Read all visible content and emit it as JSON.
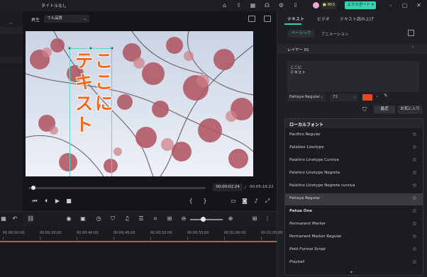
{
  "window": {
    "title": "タイトルなし",
    "credits": "863",
    "export_label": "エクスポート",
    "export_chevron": "▾"
  },
  "player": {
    "quality_label": "再生",
    "quality_value": "フル品質",
    "overlay_text_col1": "テキスト",
    "overlay_text_col2": "ここに",
    "current_time": "00:00:02:24",
    "separator": "/",
    "total_time": "00:05:16:22"
  },
  "right_panel": {
    "tabs": [
      "テキスト",
      "ビデオ",
      "テキスト読み上げ"
    ],
    "sub_tabs": [
      "ベーシック",
      "アニメーション"
    ],
    "layer_label": "レイヤー 01",
    "text_lines": [
      "ここに",
      "テキスト"
    ],
    "font_value": "Fattaya Regular",
    "size_value": "71",
    "text_color": "#e84a1e",
    "recent_label": "最近",
    "favorites_label": "お気に入り",
    "font_list_header": "ローカルフォント",
    "fonts": [
      "Pacifico Regular",
      "Palatino Linotype",
      "Palatino Linotype Cursiva",
      "Palatino Linotype Negreta",
      "Palatino Linotype Negreta cursiva",
      "Fattaya Regular",
      "Patua One",
      "Permanent Marker",
      "Permanent Marker Regular",
      "Petit Formal Script",
      "Playball"
    ],
    "selected_font_index": 5
  },
  "timeline": {
    "ticks": [
      "00:00:00:00",
      "00:00:20:00",
      "00:00:40:00",
      "00:00:45:00",
      "00:00:53:00",
      "00:00:55:00",
      "00:01:00:00",
      "00:01:05:00"
    ]
  },
  "colors": {
    "accent": "#37d1b0",
    "playhead": "#e0485c",
    "overlay_text": "#f26a1e"
  }
}
